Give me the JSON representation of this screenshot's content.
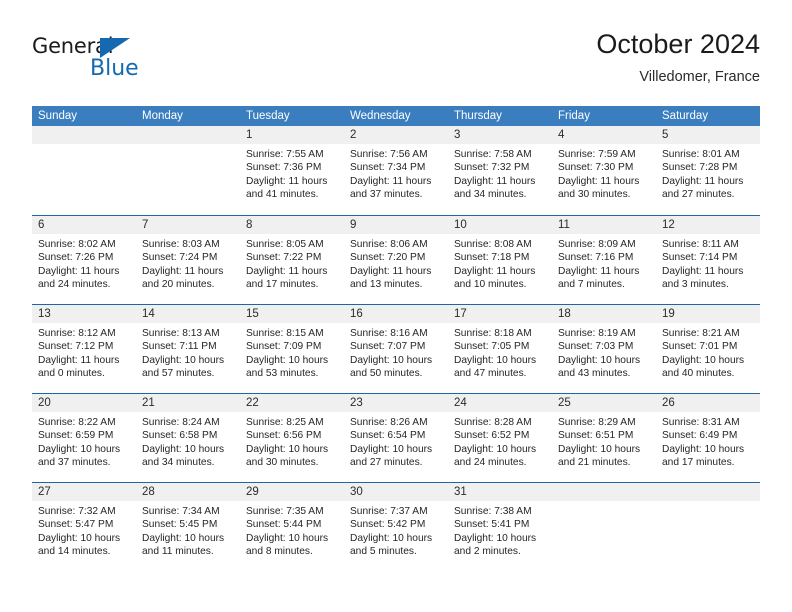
{
  "brand": {
    "name_top": "General",
    "name_bottom": "Blue",
    "accent_color": "#1569b0"
  },
  "header": {
    "title": "October 2024",
    "subtitle": "Villedomer, France"
  },
  "calendar": {
    "header_bg": "#3a7ebf",
    "row_divider_color": "#1f66a8",
    "band_bg": "#f0f0f0",
    "weekdays": [
      "Sunday",
      "Monday",
      "Tuesday",
      "Wednesday",
      "Thursday",
      "Friday",
      "Saturday"
    ],
    "weeks": [
      [
        {
          "day": "",
          "empty": true
        },
        {
          "day": "",
          "empty": true
        },
        {
          "day": "1",
          "sunrise": "Sunrise: 7:55 AM",
          "sunset": "Sunset: 7:36 PM",
          "daylight": "Daylight: 11 hours and 41 minutes."
        },
        {
          "day": "2",
          "sunrise": "Sunrise: 7:56 AM",
          "sunset": "Sunset: 7:34 PM",
          "daylight": "Daylight: 11 hours and 37 minutes."
        },
        {
          "day": "3",
          "sunrise": "Sunrise: 7:58 AM",
          "sunset": "Sunset: 7:32 PM",
          "daylight": "Daylight: 11 hours and 34 minutes."
        },
        {
          "day": "4",
          "sunrise": "Sunrise: 7:59 AM",
          "sunset": "Sunset: 7:30 PM",
          "daylight": "Daylight: 11 hours and 30 minutes."
        },
        {
          "day": "5",
          "sunrise": "Sunrise: 8:01 AM",
          "sunset": "Sunset: 7:28 PM",
          "daylight": "Daylight: 11 hours and 27 minutes."
        }
      ],
      [
        {
          "day": "6",
          "sunrise": "Sunrise: 8:02 AM",
          "sunset": "Sunset: 7:26 PM",
          "daylight": "Daylight: 11 hours and 24 minutes."
        },
        {
          "day": "7",
          "sunrise": "Sunrise: 8:03 AM",
          "sunset": "Sunset: 7:24 PM",
          "daylight": "Daylight: 11 hours and 20 minutes."
        },
        {
          "day": "8",
          "sunrise": "Sunrise: 8:05 AM",
          "sunset": "Sunset: 7:22 PM",
          "daylight": "Daylight: 11 hours and 17 minutes."
        },
        {
          "day": "9",
          "sunrise": "Sunrise: 8:06 AM",
          "sunset": "Sunset: 7:20 PM",
          "daylight": "Daylight: 11 hours and 13 minutes."
        },
        {
          "day": "10",
          "sunrise": "Sunrise: 8:08 AM",
          "sunset": "Sunset: 7:18 PM",
          "daylight": "Daylight: 11 hours and 10 minutes."
        },
        {
          "day": "11",
          "sunrise": "Sunrise: 8:09 AM",
          "sunset": "Sunset: 7:16 PM",
          "daylight": "Daylight: 11 hours and 7 minutes."
        },
        {
          "day": "12",
          "sunrise": "Sunrise: 8:11 AM",
          "sunset": "Sunset: 7:14 PM",
          "daylight": "Daylight: 11 hours and 3 minutes."
        }
      ],
      [
        {
          "day": "13",
          "sunrise": "Sunrise: 8:12 AM",
          "sunset": "Sunset: 7:12 PM",
          "daylight": "Daylight: 11 hours and 0 minutes."
        },
        {
          "day": "14",
          "sunrise": "Sunrise: 8:13 AM",
          "sunset": "Sunset: 7:11 PM",
          "daylight": "Daylight: 10 hours and 57 minutes."
        },
        {
          "day": "15",
          "sunrise": "Sunrise: 8:15 AM",
          "sunset": "Sunset: 7:09 PM",
          "daylight": "Daylight: 10 hours and 53 minutes."
        },
        {
          "day": "16",
          "sunrise": "Sunrise: 8:16 AM",
          "sunset": "Sunset: 7:07 PM",
          "daylight": "Daylight: 10 hours and 50 minutes."
        },
        {
          "day": "17",
          "sunrise": "Sunrise: 8:18 AM",
          "sunset": "Sunset: 7:05 PM",
          "daylight": "Daylight: 10 hours and 47 minutes."
        },
        {
          "day": "18",
          "sunrise": "Sunrise: 8:19 AM",
          "sunset": "Sunset: 7:03 PM",
          "daylight": "Daylight: 10 hours and 43 minutes."
        },
        {
          "day": "19",
          "sunrise": "Sunrise: 8:21 AM",
          "sunset": "Sunset: 7:01 PM",
          "daylight": "Daylight: 10 hours and 40 minutes."
        }
      ],
      [
        {
          "day": "20",
          "sunrise": "Sunrise: 8:22 AM",
          "sunset": "Sunset: 6:59 PM",
          "daylight": "Daylight: 10 hours and 37 minutes."
        },
        {
          "day": "21",
          "sunrise": "Sunrise: 8:24 AM",
          "sunset": "Sunset: 6:58 PM",
          "daylight": "Daylight: 10 hours and 34 minutes."
        },
        {
          "day": "22",
          "sunrise": "Sunrise: 8:25 AM",
          "sunset": "Sunset: 6:56 PM",
          "daylight": "Daylight: 10 hours and 30 minutes."
        },
        {
          "day": "23",
          "sunrise": "Sunrise: 8:26 AM",
          "sunset": "Sunset: 6:54 PM",
          "daylight": "Daylight: 10 hours and 27 minutes."
        },
        {
          "day": "24",
          "sunrise": "Sunrise: 8:28 AM",
          "sunset": "Sunset: 6:52 PM",
          "daylight": "Daylight: 10 hours and 24 minutes."
        },
        {
          "day": "25",
          "sunrise": "Sunrise: 8:29 AM",
          "sunset": "Sunset: 6:51 PM",
          "daylight": "Daylight: 10 hours and 21 minutes."
        },
        {
          "day": "26",
          "sunrise": "Sunrise: 8:31 AM",
          "sunset": "Sunset: 6:49 PM",
          "daylight": "Daylight: 10 hours and 17 minutes."
        }
      ],
      [
        {
          "day": "27",
          "sunrise": "Sunrise: 7:32 AM",
          "sunset": "Sunset: 5:47 PM",
          "daylight": "Daylight: 10 hours and 14 minutes."
        },
        {
          "day": "28",
          "sunrise": "Sunrise: 7:34 AM",
          "sunset": "Sunset: 5:45 PM",
          "daylight": "Daylight: 10 hours and 11 minutes."
        },
        {
          "day": "29",
          "sunrise": "Sunrise: 7:35 AM",
          "sunset": "Sunset: 5:44 PM",
          "daylight": "Daylight: 10 hours and 8 minutes."
        },
        {
          "day": "30",
          "sunrise": "Sunrise: 7:37 AM",
          "sunset": "Sunset: 5:42 PM",
          "daylight": "Daylight: 10 hours and 5 minutes."
        },
        {
          "day": "31",
          "sunrise": "Sunrise: 7:38 AM",
          "sunset": "Sunset: 5:41 PM",
          "daylight": "Daylight: 10 hours and 2 minutes."
        },
        {
          "day": "",
          "empty": true
        },
        {
          "day": "",
          "empty": true
        }
      ]
    ]
  }
}
